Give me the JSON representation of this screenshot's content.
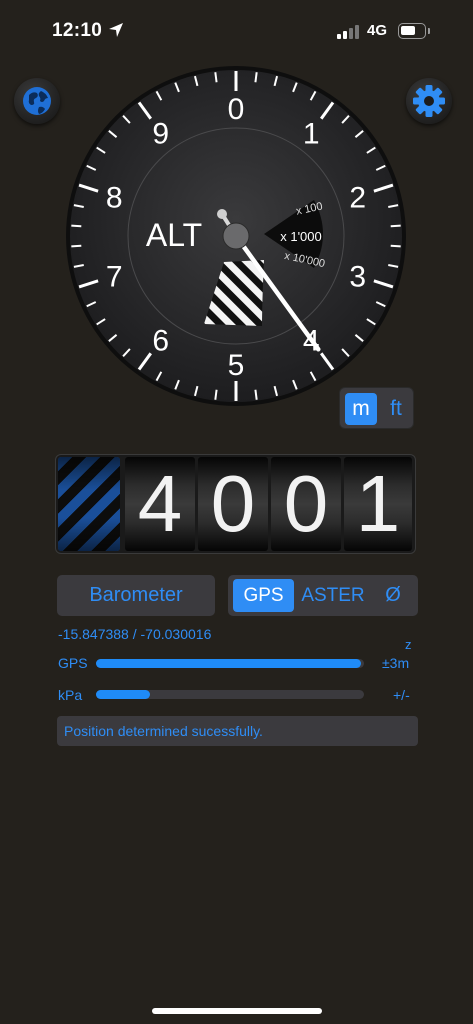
{
  "status_bar": {
    "time": "12:10",
    "network": "4G"
  },
  "dial": {
    "numerals": [
      "0",
      "1",
      "2",
      "3",
      "4",
      "5",
      "6",
      "7",
      "8",
      "9"
    ],
    "label": "ALT",
    "window_top": "x 100",
    "window_mid": "x 1'000",
    "window_bottom": "x 10'000",
    "needle_value": 4.0
  },
  "units": {
    "m_label": "m",
    "ft_label": "ft",
    "selected": "m"
  },
  "altitude": {
    "digits": [
      "4",
      "0",
      "0",
      "1"
    ]
  },
  "source": {
    "barometer_label": "Barometer",
    "gps_label": "GPS",
    "aster_label": "ASTER",
    "none_label": "Ø",
    "selected": "GPS"
  },
  "position": {
    "coords": "-15.847388 / -70.030016",
    "z_label": "z"
  },
  "gps_row": {
    "label": "GPS",
    "value": "±3m",
    "level": 0.99
  },
  "kpa_row": {
    "label": "kPa",
    "value": "+/-",
    "level": 0.2
  },
  "status_message": "Position determined sucessfully.",
  "colors": {
    "accent": "#2f8df5",
    "background": "#24211c",
    "panel": "#3b3a3e"
  },
  "icons": {
    "globe": "globe-icon",
    "settings": "gear-icon",
    "location": "location-arrow-icon"
  }
}
